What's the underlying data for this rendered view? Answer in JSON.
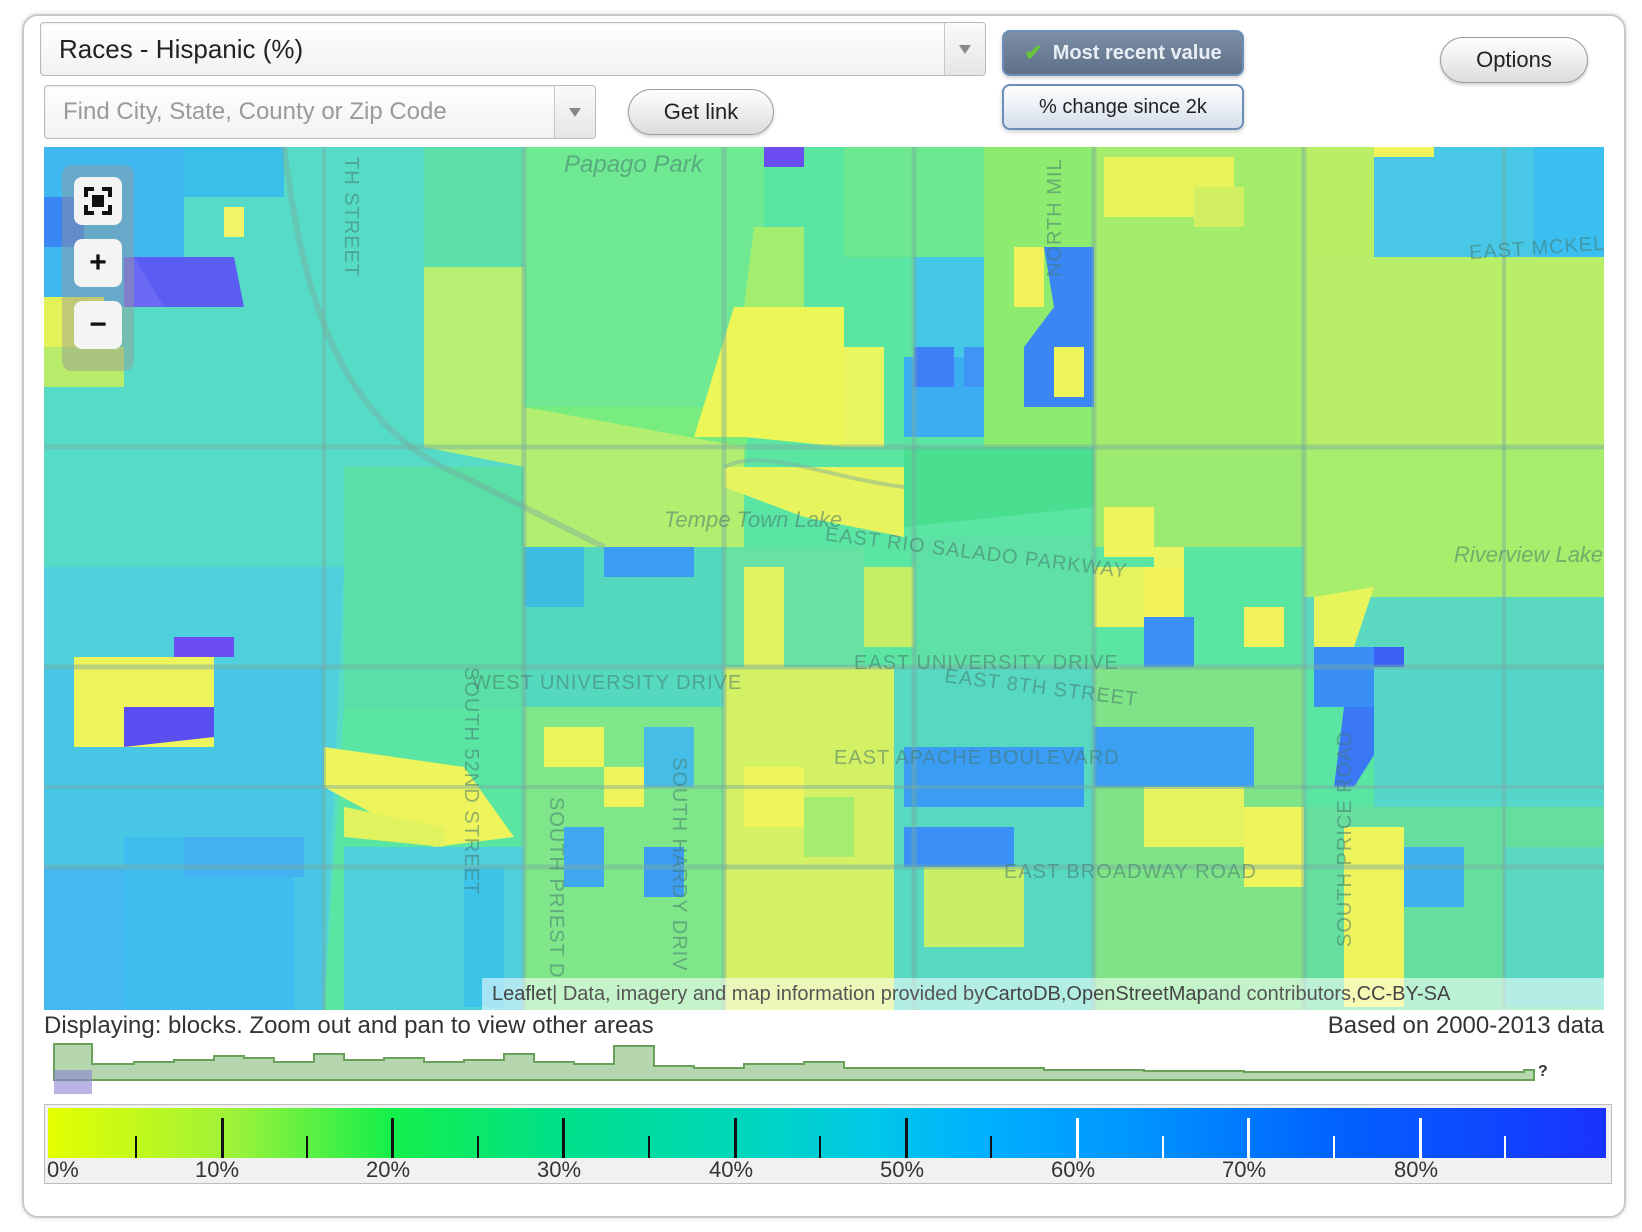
{
  "controls": {
    "metric": "Races - Hispanic (%)",
    "search_placeholder": "Find City, State, County or Zip Code",
    "get_link": "Get link",
    "most_recent": "Most recent value",
    "pct_change": "% change since 2k",
    "options": "Options"
  },
  "map": {
    "labels": {
      "papago": "Papago Park",
      "tempe_lake": "Tempe Town Lake",
      "rio_salado": "EAST RIO SALADO PARKWAY",
      "riverview": "Riverview Lake",
      "east_mckell": "EAST MCKELL",
      "east_university": "EAST UNIVERSITY DRIVE",
      "west_university": "WEST UNIVERSITY DRIVE",
      "east_8th": "EAST 8TH STREET",
      "east_apache": "EAST APACHE BOULEVARD",
      "east_broadway": "EAST BROADWAY ROAD",
      "south_52nd": "SOUTH 52ND STREET",
      "south_priest": "SOUTH PRIEST D",
      "south_hardy": "SOUTH HARDY DRIV",
      "south_price": "SOUTH PRICE ROAD",
      "north_mil": "NORTH MIL",
      "th_street": "TH STREET"
    },
    "attribution": {
      "leaflet": "Leaflet",
      "sep": " | Data, imagery and map information provided by ",
      "cartodb": "CartoDB",
      "comma": ", ",
      "osm": "OpenStreetMap",
      "and": " and contributors, ",
      "license": "CC-BY-SA"
    }
  },
  "status": {
    "displaying": "Displaying: blocks. Zoom out and pan to view other areas",
    "based_on": "Based on 2000-2013 data",
    "histogram_end": "?"
  },
  "legend": {
    "labels": [
      "0%",
      "10%",
      "20%",
      "30%",
      "40%",
      "50%",
      "60%",
      "70%",
      "80%"
    ],
    "gradient_colors": [
      "#e4ff00",
      "#14f04a",
      "#00d7b8",
      "#00b0ff",
      "#1a32ff"
    ]
  }
}
